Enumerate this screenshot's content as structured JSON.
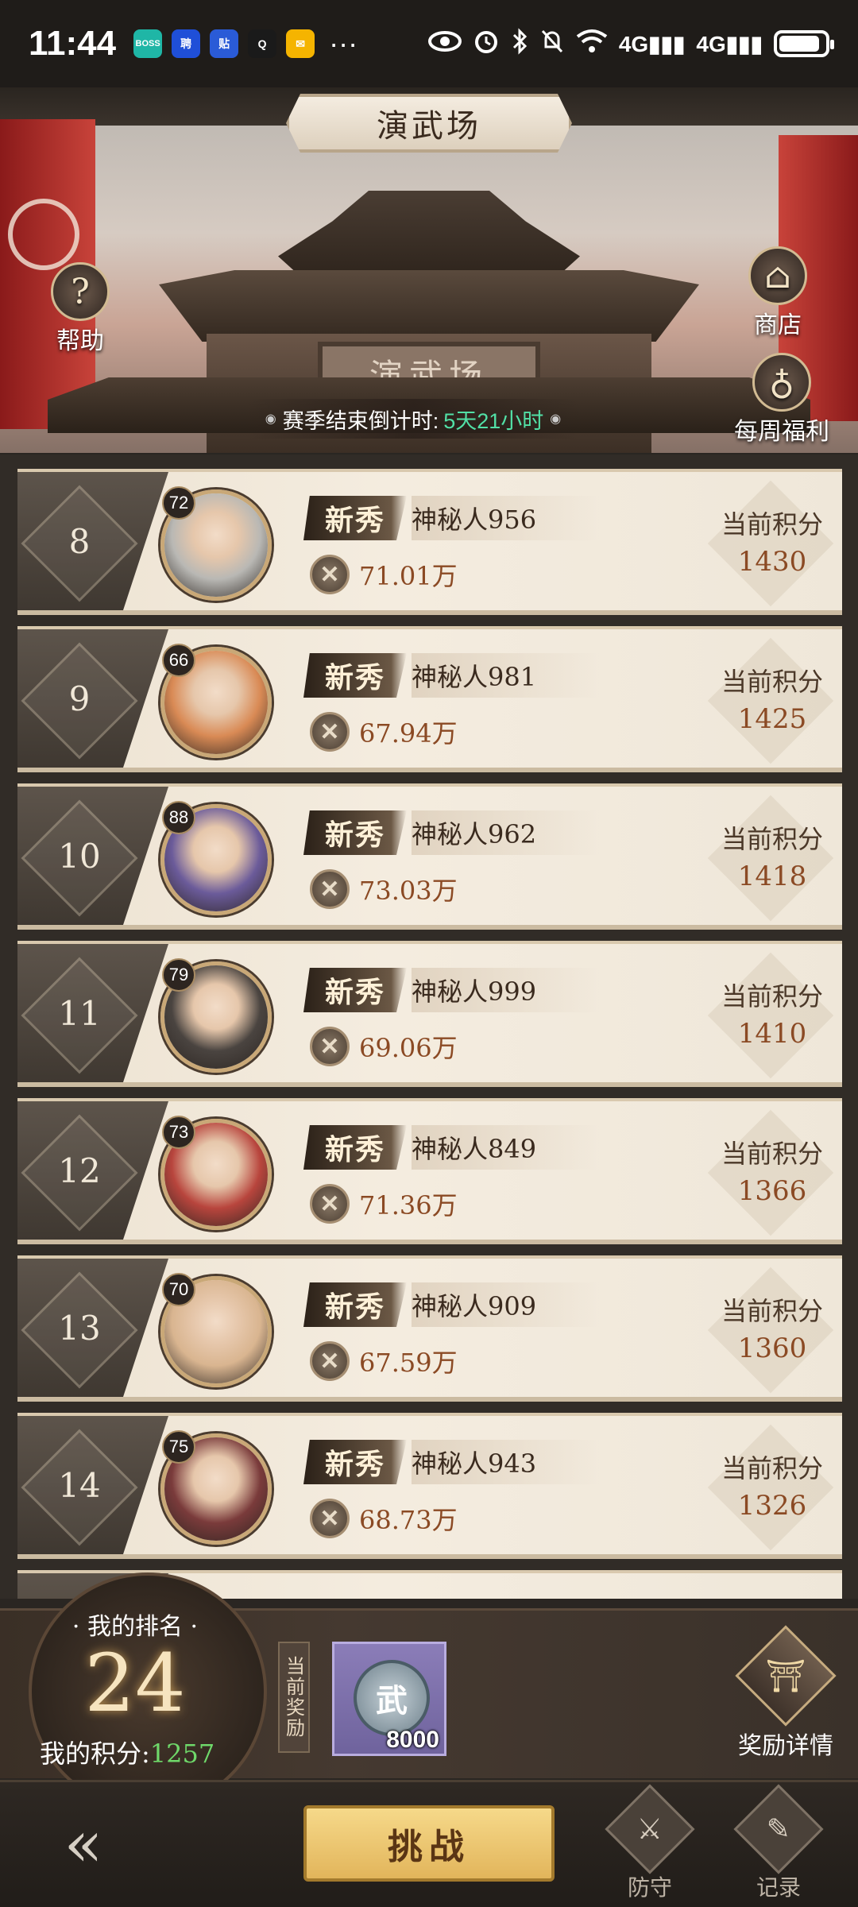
{
  "status_bar": {
    "time": "11:44",
    "app_icons": [
      {
        "name": "boss-icon",
        "text": "BOSS",
        "color": "#1fb6a6"
      },
      {
        "name": "zhaopin-icon",
        "text": "聘",
        "color": "#1f4fd8"
      },
      {
        "name": "tieba-icon",
        "text": "贴",
        "color": "#2a5bd7"
      },
      {
        "name": "qq-icon",
        "text": "Q",
        "color": "#1a1a1a"
      },
      {
        "name": "mail-icon",
        "text": "✉",
        "color": "#f5b400"
      }
    ],
    "more": "···",
    "right_icons": [
      "eye-icon",
      "alarm-icon",
      "bluetooth-icon",
      "mute-icon",
      "wifi-icon"
    ],
    "signal1": "4G",
    "signal2": "4G",
    "battery_level": 0.9
  },
  "header": {
    "title": "演武场",
    "plaque": "演武场"
  },
  "side_buttons": {
    "help": "帮助",
    "shop": "商店",
    "weekly": "每周福利"
  },
  "season": {
    "label": "赛季结束倒计时:",
    "value": "5天21小时"
  },
  "rankings": [
    {
      "rank": "8",
      "level": "72",
      "tag": "新秀",
      "name": "神秘人956",
      "power": "71.01万",
      "score_label": "当前积分",
      "score": "1430",
      "avatar_color": "#b9b8b4"
    },
    {
      "rank": "9",
      "level": "66",
      "tag": "新秀",
      "name": "神秘人981",
      "power": "67.94万",
      "score_label": "当前积分",
      "score": "1425",
      "avatar_color": "#d98a55"
    },
    {
      "rank": "10",
      "level": "88",
      "tag": "新秀",
      "name": "神秘人962",
      "power": "73.03万",
      "score_label": "当前积分",
      "score": "1418",
      "avatar_color": "#6b5b9a"
    },
    {
      "rank": "11",
      "level": "79",
      "tag": "新秀",
      "name": "神秘人999",
      "power": "69.06万",
      "score_label": "当前积分",
      "score": "1410",
      "avatar_color": "#4a4440"
    },
    {
      "rank": "12",
      "level": "73",
      "tag": "新秀",
      "name": "神秘人849",
      "power": "71.36万",
      "score_label": "当前积分",
      "score": "1366",
      "avatar_color": "#b8453d"
    },
    {
      "rank": "13",
      "level": "70",
      "tag": "新秀",
      "name": "神秘人909",
      "power": "67.59万",
      "score_label": "当前积分",
      "score": "1360",
      "avatar_color": "#d9b590"
    },
    {
      "rank": "14",
      "level": "75",
      "tag": "新秀",
      "name": "神秘人943",
      "power": "68.73万",
      "score_label": "当前积分",
      "score": "1326",
      "avatar_color": "#7a3b3b"
    }
  ],
  "my": {
    "rank_label": "· 我的排名 ·",
    "rank": "24",
    "score_label": "我的积分:",
    "score": "1257"
  },
  "reward": {
    "tag": "当前奖励",
    "coin_glyph": "武",
    "quantity": "8000",
    "detail_label": "奖励详情"
  },
  "bottom_nav": {
    "challenge": "挑战",
    "defend": "防守",
    "record": "记录"
  }
}
